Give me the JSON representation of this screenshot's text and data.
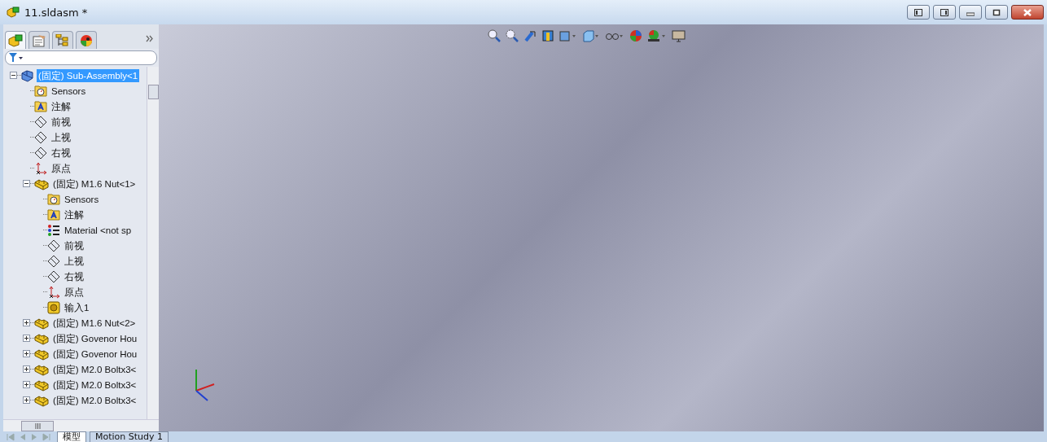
{
  "window": {
    "title": "11.sldasm *"
  },
  "tree": [
    {
      "label": "(固定) Sub-Assembly<1",
      "kind": "assembly",
      "selected": true,
      "expanded": true,
      "children": [
        {
          "label": "Sensors",
          "kind": "sensors",
          "selected": false
        },
        {
          "label": "注解",
          "kind": "annotations",
          "selected": false
        },
        {
          "label": "前视",
          "kind": "plane",
          "selected": false
        },
        {
          "label": "上视",
          "kind": "plane",
          "selected": false
        },
        {
          "label": "右视",
          "kind": "plane",
          "selected": false
        },
        {
          "label": "原点",
          "kind": "origin",
          "selected": false
        },
        {
          "label": "(固定) M1.6 Nut<1>",
          "kind": "part",
          "selected": false,
          "expanded": true,
          "children": [
            {
              "label": "Sensors",
              "kind": "sensors",
              "selected": false
            },
            {
              "label": "注解",
              "kind": "annotations",
              "selected": false
            },
            {
              "label": "Material <not sp",
              "kind": "material",
              "selected": false
            },
            {
              "label": "前视",
              "kind": "plane",
              "selected": false
            },
            {
              "label": "上视",
              "kind": "plane",
              "selected": false
            },
            {
              "label": "右视",
              "kind": "plane",
              "selected": false
            },
            {
              "label": "原点",
              "kind": "origin",
              "selected": false
            },
            {
              "label": "输入1",
              "kind": "feature",
              "selected": false
            }
          ]
        },
        {
          "label": "(固定) M1.6 Nut<2>",
          "kind": "part",
          "selected": false,
          "expanded": false
        },
        {
          "label": "(固定) Govenor Hou",
          "kind": "part",
          "selected": false,
          "expanded": false
        },
        {
          "label": "(固定) Govenor Hou",
          "kind": "part",
          "selected": false,
          "expanded": false
        },
        {
          "label": "(固定) M2.0 Boltx3<",
          "kind": "part",
          "selected": false,
          "expanded": false
        },
        {
          "label": "(固定) M2.0 Boltx3<",
          "kind": "part",
          "selected": false,
          "expanded": false
        },
        {
          "label": "(固定) M2.0 Boltx3<",
          "kind": "part",
          "selected": false,
          "expanded": false
        }
      ]
    }
  ],
  "bottom_tabs": [
    {
      "label": "模型",
      "selected": true
    },
    {
      "label": "Motion Study 1",
      "selected": false
    }
  ]
}
